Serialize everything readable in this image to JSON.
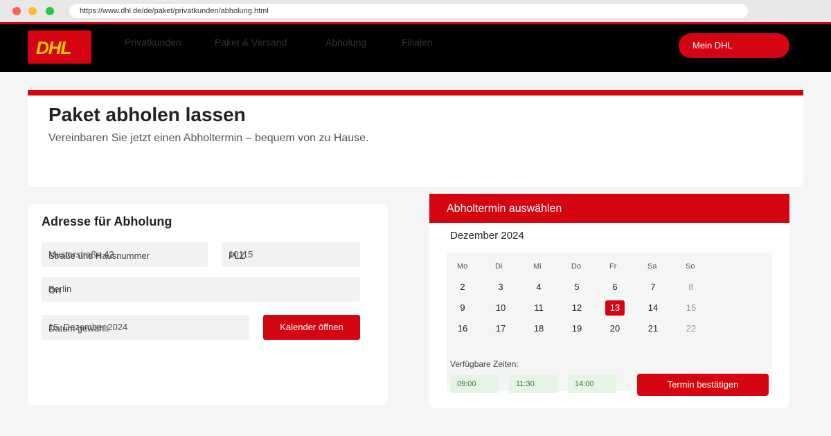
{
  "browser": {
    "url": "https://www.dhl.de/de/paket/privatkunden/abholung.html"
  },
  "header": {
    "logo_text": "DHL",
    "nav": [
      "Privatkunden",
      "Paket & Versand",
      "Abholung",
      "Filialen"
    ],
    "account_button": "Mein DHL"
  },
  "hero": {
    "title": "Paket abholen lassen",
    "subtitle": "Vereinbaren Sie jetzt einen Abholtermin – bequem von zu Hause."
  },
  "address_form": {
    "title": "Adresse für Abholung",
    "street": {
      "placeholder": "Straße und Hausnummer",
      "value": "Musterstraße 42"
    },
    "zip": {
      "placeholder": "PLZ",
      "value": "10115"
    },
    "city": {
      "placeholder": "Ort",
      "value": "Berlin"
    },
    "date": {
      "placeholder": "Datum gewählt",
      "value": "15. Dezember 2024"
    },
    "calendar_button": "Kalender öffnen"
  },
  "calendar": {
    "header": "Abholtermin auswählen",
    "month": "Dezember 2024",
    "weekdays": [
      "Mo",
      "Di",
      "Mi",
      "Do",
      "Fr",
      "Sa",
      "So"
    ],
    "weeks": [
      [
        "2",
        "3",
        "4",
        "5",
        "6",
        "7",
        "8"
      ],
      [
        "9",
        "10",
        "11",
        "12",
        "13",
        "14",
        "15"
      ],
      [
        "16",
        "17",
        "18",
        "19",
        "20",
        "21",
        "22"
      ]
    ],
    "selected_day": "13",
    "muted_days": [
      "8",
      "15",
      "22"
    ],
    "times_label": "Verfügbare Zeiten:",
    "times": [
      "09:00",
      "11:30",
      "14:00"
    ],
    "confirm_button": "Termin bestätigen"
  },
  "colors": {
    "brand_red": "#d40511",
    "brand_yellow": "#ffcc00",
    "slot_green": "#e6f4e6"
  }
}
